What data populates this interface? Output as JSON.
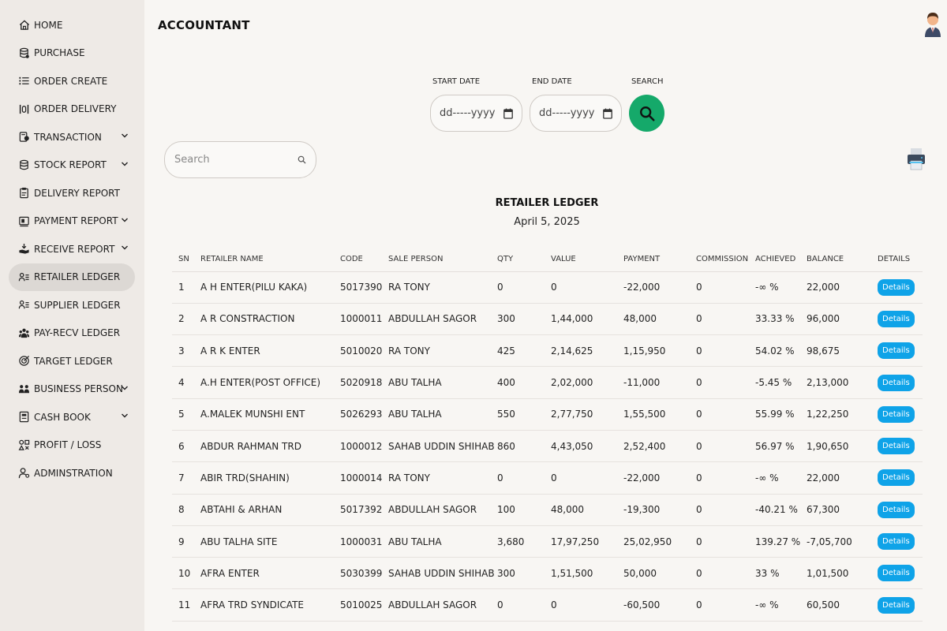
{
  "app": {
    "title": "ACCOUNTANT"
  },
  "sidebar": {
    "items": [
      {
        "label": "HOME",
        "icon": "home-icon",
        "dropdown": false
      },
      {
        "label": "PURCHASE",
        "icon": "database-icon",
        "dropdown": false
      },
      {
        "label": "ORDER CREATE",
        "icon": "list-icon",
        "dropdown": false
      },
      {
        "label": "ORDER DELIVERY",
        "icon": "barcode-icon",
        "dropdown": false
      },
      {
        "label": "TRANSACTION",
        "icon": "money-icon",
        "dropdown": true
      },
      {
        "label": "STOCK REPORT",
        "icon": "stack-icon",
        "dropdown": true
      },
      {
        "label": "DELIVERY REPORT",
        "icon": "clipboard-icon",
        "dropdown": false
      },
      {
        "label": "PAYMENT REPORT",
        "icon": "payment-icon",
        "dropdown": true
      },
      {
        "label": "RECEIVE REPORT",
        "icon": "receive-icon",
        "dropdown": true
      },
      {
        "label": "RETAILER LEDGER",
        "icon": "user-list-icon",
        "dropdown": false,
        "active": true
      },
      {
        "label": "SUPPLIER LEDGER",
        "icon": "user-list-icon",
        "dropdown": false
      },
      {
        "label": "PAY-RECV LEDGER",
        "icon": "people-icon",
        "dropdown": false
      },
      {
        "label": "TARGET LEDGER",
        "icon": "target-icon",
        "dropdown": false
      },
      {
        "label": "BUSINESS PERSON",
        "icon": "group-icon",
        "dropdown": true
      },
      {
        "label": "CASH BOOK",
        "icon": "book-icon",
        "dropdown": true
      },
      {
        "label": "PROFIT / LOSS",
        "icon": "shapes-icon",
        "dropdown": false
      },
      {
        "label": "ADMINSTRATION",
        "icon": "admin-icon",
        "dropdown": false
      }
    ]
  },
  "filters": {
    "start_label": "START DATE",
    "start_value": "dd-----yyyy",
    "end_label": "END DATE",
    "end_value": "dd-----yyyy",
    "search_label": "SEARCH"
  },
  "search": {
    "placeholder": "Search"
  },
  "report": {
    "title": "RETAILER LEDGER",
    "date": "April 5, 2025"
  },
  "table": {
    "headers": [
      "SN",
      "RETAILER NAME",
      "CODE",
      "SALE PERSON",
      "QTY",
      "VALUE",
      "PAYMENT",
      "COMMISSION",
      "ACHIEVED",
      "BALANCE",
      "DETAILS"
    ],
    "details_label": "Details",
    "rows": [
      [
        "1",
        "A H ENTER(PILU KAKA)",
        "5017390",
        "RA TONY",
        "0",
        "0",
        "-22,000",
        "0",
        "-∞ %",
        "22,000"
      ],
      [
        "2",
        "A R CONSTRACTION",
        "1000011",
        "ABDULLAH SAGOR",
        "300",
        "1,44,000",
        "48,000",
        "0",
        "33.33 %",
        "96,000"
      ],
      [
        "3",
        "A R K ENTER",
        "5010020",
        "RA TONY",
        "425",
        "2,14,625",
        "1,15,950",
        "0",
        "54.02 %",
        "98,675"
      ],
      [
        "4",
        "A.H ENTER(POST OFFICE)",
        "5020918",
        "ABU TALHA",
        "400",
        "2,02,000",
        "-11,000",
        "0",
        "-5.45 %",
        "2,13,000"
      ],
      [
        "5",
        "A.MALEK MUNSHI ENT",
        "5026293",
        "ABU TALHA",
        "550",
        "2,77,750",
        "1,55,500",
        "0",
        "55.99 %",
        "1,22,250"
      ],
      [
        "6",
        "ABDUR RAHMAN TRD",
        "1000012",
        "SAHAB UDDIN SHIHAB",
        "860",
        "4,43,050",
        "2,52,400",
        "0",
        "56.97 %",
        "1,90,650"
      ],
      [
        "7",
        "ABIR TRD(SHAHIN)",
        "1000014",
        "RA TONY",
        "0",
        "0",
        "-22,000",
        "0",
        "-∞ %",
        "22,000"
      ],
      [
        "8",
        "ABTAHI & ARHAN",
        "5017392",
        "ABDULLAH SAGOR",
        "100",
        "48,000",
        "-19,300",
        "0",
        "-40.21 %",
        "67,300"
      ],
      [
        "9",
        "ABU TALHA SITE",
        "1000031",
        "ABU TALHA",
        "3,680",
        "17,97,250",
        "25,02,950",
        "0",
        "139.27 %",
        "-7,05,700"
      ],
      [
        "10",
        "AFRA ENTER",
        "5030399",
        "SAHAB UDDIN SHIHAB",
        "300",
        "1,51,500",
        "50,000",
        "0",
        "33 %",
        "1,01,500"
      ],
      [
        "11",
        "AFRA TRD SYNDICATE",
        "5010025",
        "ABDULLAH SAGOR",
        "0",
        "0",
        "-60,500",
        "0",
        "-∞ %",
        "60,500"
      ]
    ]
  },
  "colors": {
    "sidebar_bg": "#eeeae6",
    "active_item_bg": "#dcd8d4",
    "search_button": "#15a96a",
    "details_button": "#0fa3e8"
  }
}
